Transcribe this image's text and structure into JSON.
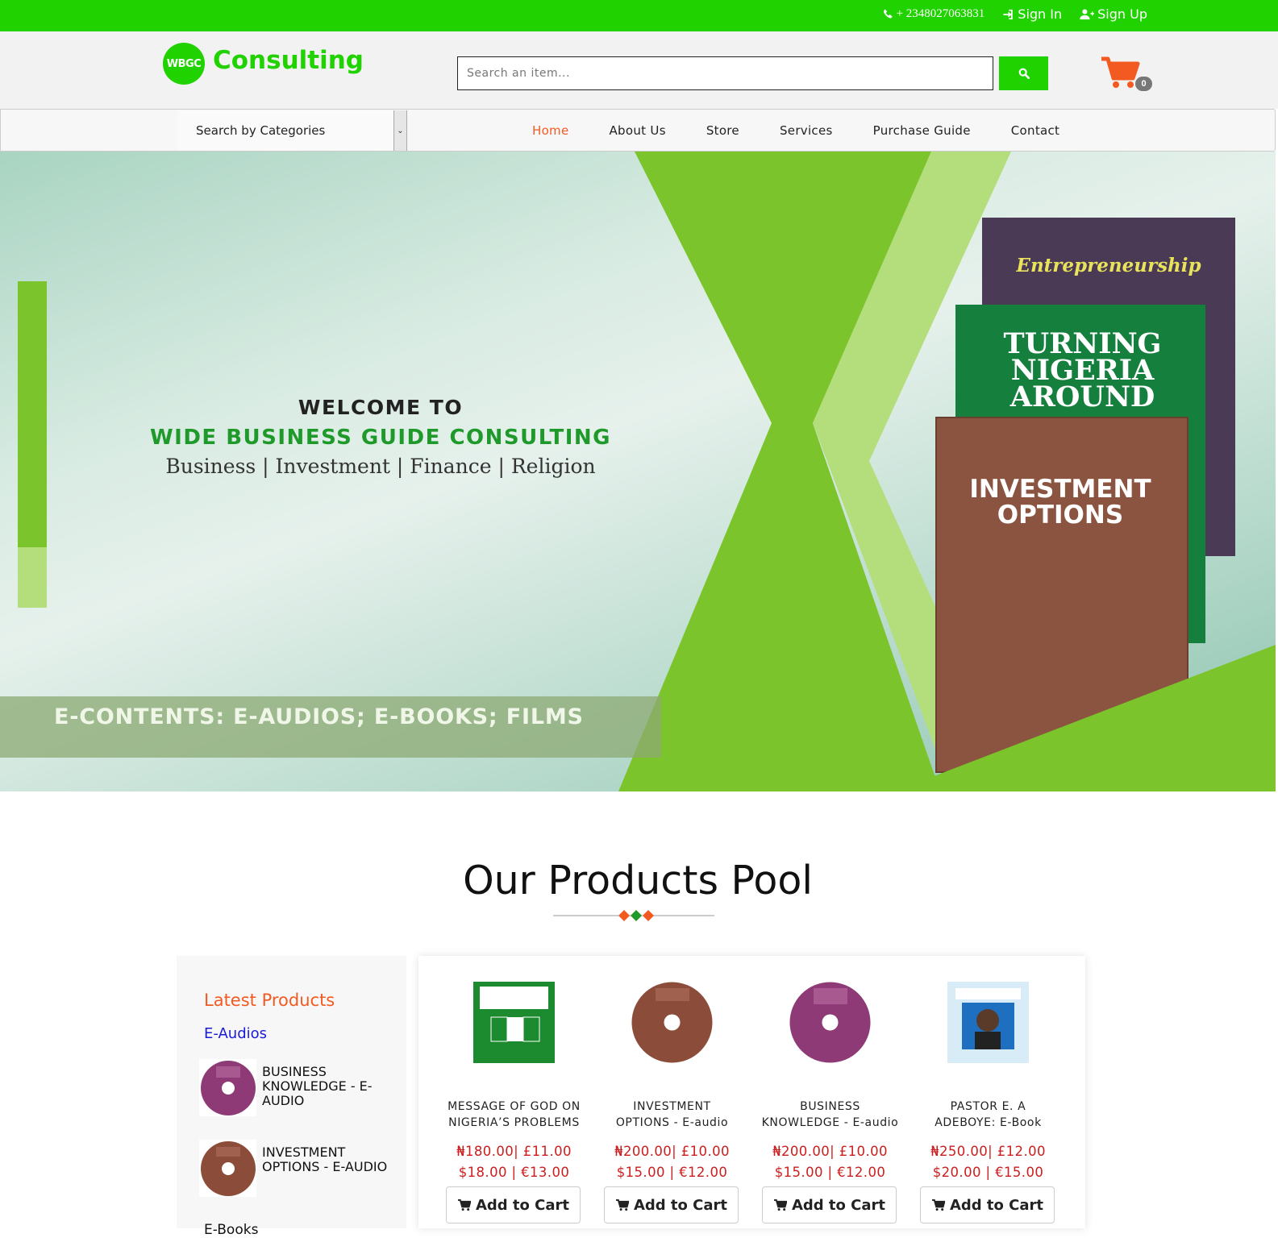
{
  "topbar": {
    "phone": "+ 2348027063831",
    "sign_in": "Sign In",
    "sign_up": "Sign Up"
  },
  "header": {
    "logo_badge": "WBGC",
    "logo_text": "Consulting",
    "search_placeholder": "Search an item...",
    "cart_count": "0"
  },
  "nav": {
    "category_select": "Search by Categories",
    "items": [
      "Home",
      "About Us",
      "Store",
      "Services",
      "Purchase Guide",
      "Contact"
    ],
    "active": "Home"
  },
  "hero": {
    "welcome": "WELCOME TO",
    "company": "WIDE BUSINESS GUIDE CONSULTING",
    "tagline": "Business | Investment | Finance | Religion",
    "strip": "E-CONTENTS: E-AUDIOS; E-BOOKS; FILMS",
    "book1_title": "Entrepreneurship",
    "book2_title": "TURNING NIGERIA AROUND",
    "book3_title": "INVESTMENT OPTIONS"
  },
  "products_section": {
    "title": "Our Products Pool"
  },
  "sidebar": {
    "title": "Latest Products",
    "subtitle": "E-Audios",
    "items": [
      {
        "label": "BUSINESS KNOWLEDGE - E-AUDIO"
      },
      {
        "label": "INVESTMENT OPTIONS - E-AUDIO"
      }
    ],
    "next_heading": "E-Books"
  },
  "products": [
    {
      "name_line1": "MESSAGE OF GOD ON",
      "name_line2": "NIGERIA’S PROBLEMS",
      "price1": "₦180.00| £11.00",
      "price2": "$18.00 | €13.00",
      "button": "Add to Cart"
    },
    {
      "name_line1": "INVESTMENT",
      "name_line2": "OPTIONS - E-audio",
      "price1": "₦200.00| £10.00",
      "price2": "$15.00 | €12.00",
      "button": "Add to Cart"
    },
    {
      "name_line1": "BUSINESS",
      "name_line2": "KNOWLEDGE - E-audio",
      "price1": "₦200.00| £10.00",
      "price2": "$15.00 | €12.00",
      "button": "Add to Cart"
    },
    {
      "name_line1": "PASTOR E. A",
      "name_line2": "ADEBOYE: E-Book",
      "price1": "₦250.00| £12.00",
      "price2": "$20.00 | €15.00",
      "button": "Add to Cart"
    }
  ],
  "colors": {
    "brand_green": "#1fd200",
    "accent_orange": "#f25a22",
    "price_red": "#cc1e1e",
    "link_blue": "#1a1adc"
  }
}
